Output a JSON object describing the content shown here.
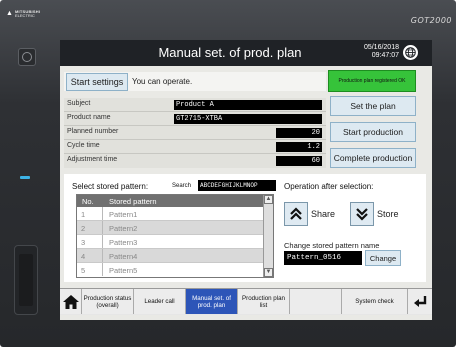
{
  "device": {
    "brand_line1": "MITSUBISHI",
    "brand_line2": "ELECTRIC",
    "model": "GOT2000"
  },
  "header": {
    "title": "Manual set. of prod. plan",
    "date": "05/16/2018",
    "time": "09:47:07",
    "globe_icon": "globe-icon"
  },
  "status": {
    "start_settings_label": "Start settings",
    "message": "You can operate.",
    "registered_badge": "Production plan registered OK",
    "badge_color": "#36c33a"
  },
  "plan_info": {
    "rows": [
      {
        "label": "Subject",
        "value": "Product A"
      },
      {
        "label": "Product name",
        "value": "GT2715-XTBA"
      },
      {
        "label": "Planned number",
        "value": "20"
      },
      {
        "label": "Cycle time",
        "value": "1.2"
      },
      {
        "label": "Adjustment time",
        "value": "60"
      }
    ]
  },
  "actions": {
    "set_plan": "Set the plan",
    "start_production": "Start production",
    "complete_production": "Complete production"
  },
  "stored_pattern": {
    "title": "Select stored pattern:",
    "search_label": "Search",
    "search_value": "ABCDEFGHIJKLMNOP",
    "columns": [
      "No.",
      "Stored pattern"
    ],
    "rows": [
      {
        "no": "1",
        "name": "Pattern1"
      },
      {
        "no": "2",
        "name": "Pattern2"
      },
      {
        "no": "3",
        "name": "Pattern3"
      },
      {
        "no": "4",
        "name": "Pattern4"
      },
      {
        "no": "5",
        "name": "Pattern5"
      }
    ]
  },
  "operation": {
    "title": "Operation after selection:",
    "share_label": "Share",
    "store_label": "Store",
    "change_title": "Change stored pattern name",
    "pattern_name": "Pattern_0516",
    "change_label": "Change"
  },
  "nav": {
    "home_icon": "home-icon",
    "items": [
      {
        "label": "Production status (overall)"
      },
      {
        "label": "Leader call"
      },
      {
        "label": "Manual set. of prod. plan",
        "active": true
      },
      {
        "label": "Production plan list"
      },
      {
        "label": ""
      },
      {
        "label": "System check"
      }
    ],
    "return_icon": "return-icon",
    "active_color": "#2d55b8"
  }
}
